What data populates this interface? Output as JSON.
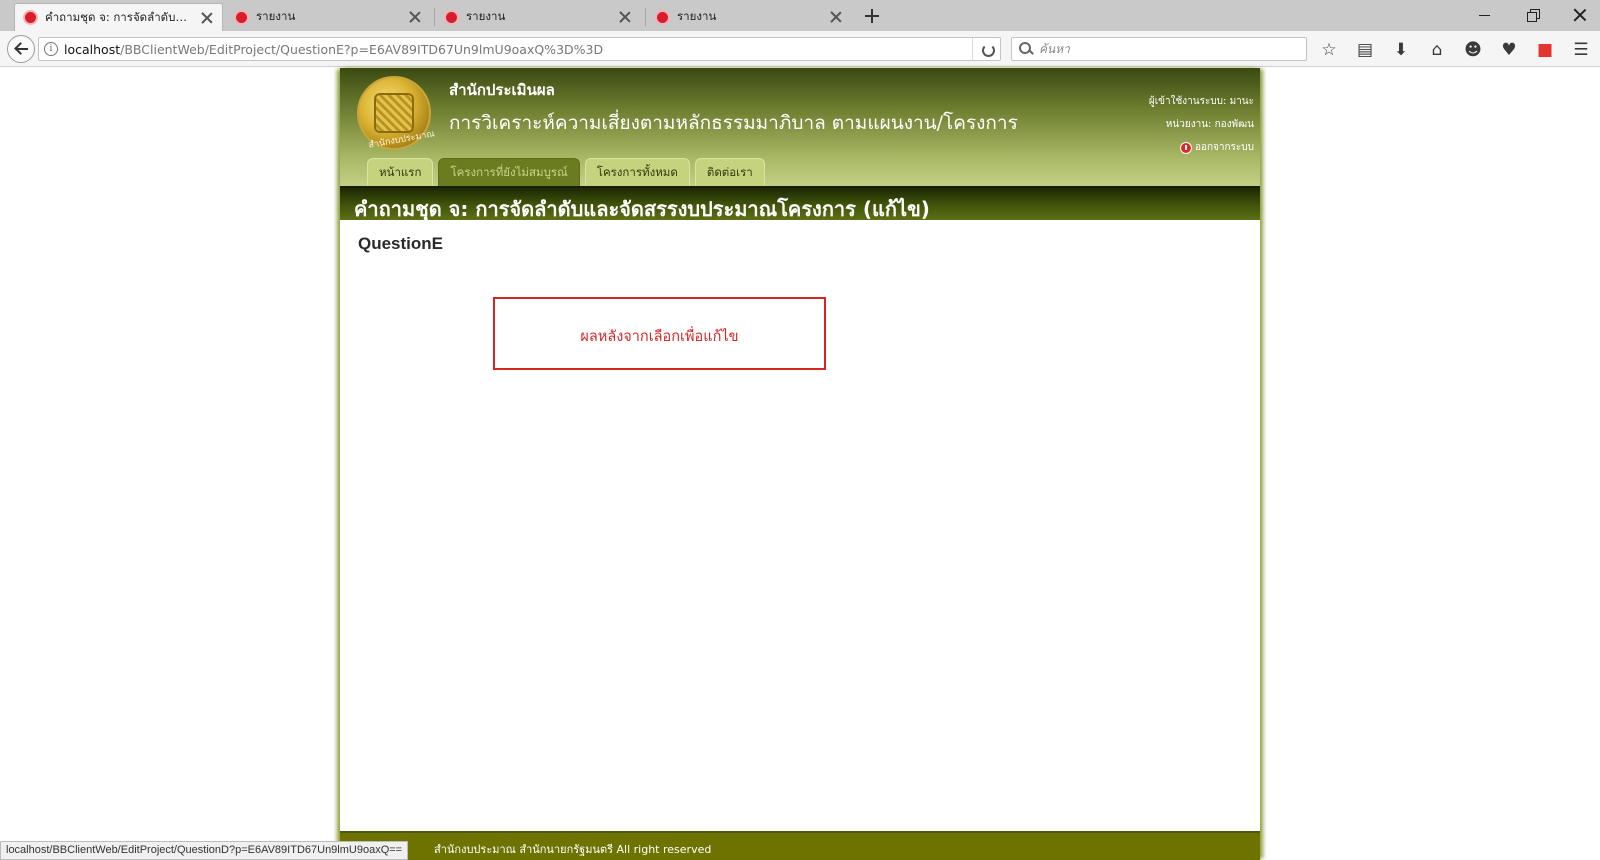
{
  "browser": {
    "tabs": [
      {
        "title": "คำถามชุด จ: การจัดลำดับและจัดสรรงบประมาณโครงการ (แก้ไข)"
      },
      {
        "title": "รายงาน"
      },
      {
        "title": "รายงาน"
      },
      {
        "title": "รายงาน"
      }
    ],
    "url_host": "localhost",
    "url_path": "/BBClientWeb/EditProject/QuestionE?p=E6AV89ITD67Un9lmU9oaxQ%3D%3D",
    "search_placeholder": "ค้นหา",
    "status_url": "localhost/BBClientWeb/EditProject/QuestionD?p=E6AV89ITD67Un9lmU9oaxQ=="
  },
  "header": {
    "org_name": "สำนักประเมินผล",
    "system_title": "การวิเคราะห์ความเสี่ยงตามหลักธรรมมาภิบาล ตามแผนงาน/โครงการ",
    "logo_text": "สำนักงบประมาณ",
    "user_label": "ผู้เข้าใช้งานระบบ: มานะ",
    "unit_label": "หน่วยงาน: กองพัฒน",
    "logout_label": "ออกจากระบบ"
  },
  "menu": [
    {
      "label": "หน้าแรก",
      "active": false
    },
    {
      "label": "โครงการที่ยังไม่สมบูรณ์",
      "active": true
    },
    {
      "label": "โครงการทั้งหมด",
      "active": false
    },
    {
      "label": "ติดต่อเรา",
      "active": false
    }
  ],
  "main": {
    "page_title": "คำถามชุด จ: การจัดลำดับและจัดสรรงบประมาณโครงการ (แก้ไข)",
    "question_heading": "QuestionE",
    "result_text": "ผลหลังจากเลือกเพื่อแก้ไข"
  },
  "footer": {
    "text": "สำนักงบประมาณ สำนักนายกรัฐมนตรี All right reserved"
  },
  "colors": {
    "header_dark": "#3b4a12",
    "header_light": "#c6d289",
    "title_bar": "#3f5209",
    "footer": "#6e7300",
    "alert_red": "#d52626"
  }
}
